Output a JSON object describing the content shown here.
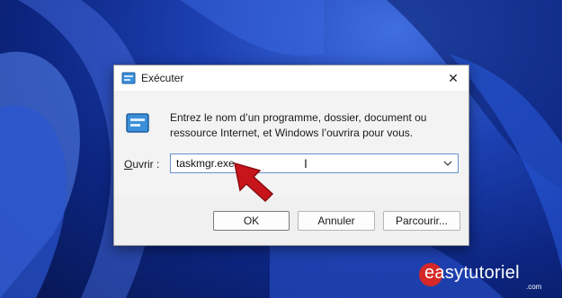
{
  "window": {
    "title": "Exécuter",
    "close_glyph": "✕"
  },
  "dialog": {
    "description": "Entrez le nom d’un programme, dossier, document ou ressource Internet, et Windows l’ouvrira pour vous.",
    "open_label_prefix": "",
    "open_label_accel": "O",
    "open_label_rest": "uvrir :",
    "input_value": "taskmgr.exe"
  },
  "buttons": {
    "ok": "OK",
    "cancel": "Annuler",
    "browse": "Parcourir..."
  },
  "watermark": {
    "brand": "easytutoriel",
    "sub": ".com"
  },
  "colors": {
    "wallpaper": "#1c3fb0",
    "arrow": "#c8151b",
    "brand_accent": "#d62828"
  },
  "icons": [
    "run-app-icon",
    "run-dialog-icon",
    "close-icon",
    "chevron-down-icon",
    "text-cursor-icon",
    "red-pointer-arrow"
  ]
}
